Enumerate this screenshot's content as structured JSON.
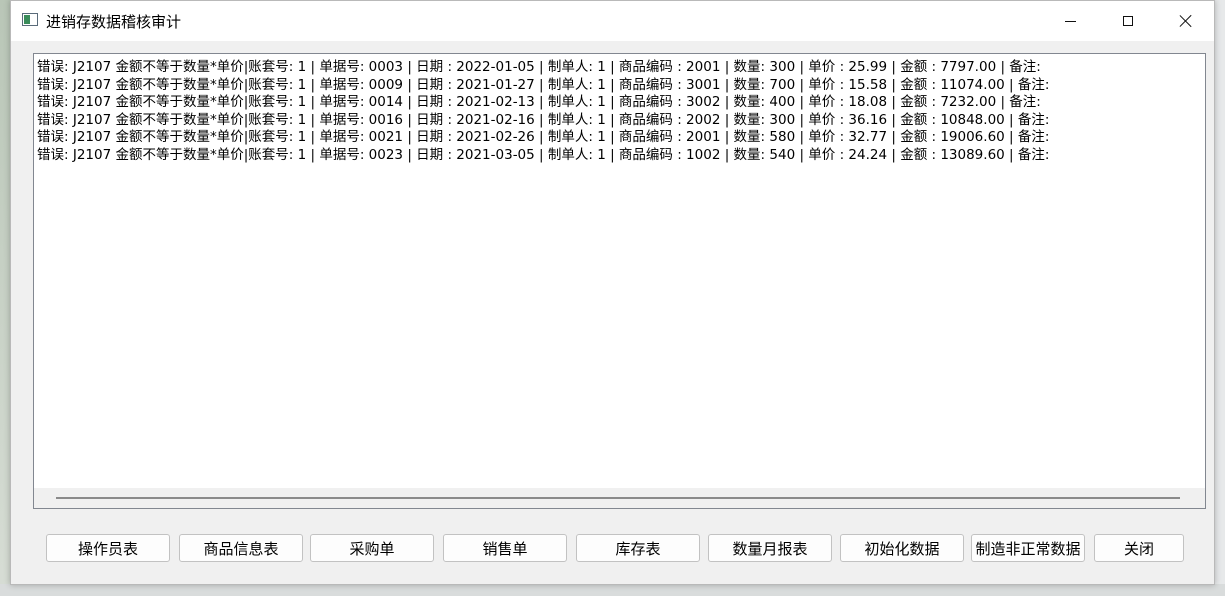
{
  "window": {
    "title": "进销存数据稽核审计"
  },
  "log": {
    "lines": [
      "错误: J2107 金额不等于数量*单价|账套号: 1 | 单据号: 0003 | 日期 : 2022-01-05 | 制单人: 1 | 商品编码 : 2001 | 数量: 300 | 单价 : 25.99 | 金额 : 7797.00 | 备注:",
      "错误: J2107 金额不等于数量*单价|账套号: 1 | 单据号: 0009 | 日期 : 2021-01-27 | 制单人: 1 | 商品编码 : 3001 | 数量: 700 | 单价 : 15.58 | 金额 : 11074.00 | 备注:",
      "错误: J2107 金额不等于数量*单价|账套号: 1 | 单据号: 0014 | 日期 : 2021-02-13 | 制单人: 1 | 商品编码 : 3002 | 数量: 400 | 单价 : 18.08 | 金额 : 7232.00 | 备注:",
      "错误: J2107 金额不等于数量*单价|账套号: 1 | 单据号: 0016 | 日期 : 2021-02-16 | 制单人: 1 | 商品编码 : 2002 | 数量: 300 | 单价 : 36.16 | 金额 : 10848.00 | 备注:",
      "错误: J2107 金额不等于数量*单价|账套号: 1 | 单据号: 0021 | 日期 : 2021-02-26 | 制单人: 1 | 商品编码 : 2001 | 数量: 580 | 单价 : 32.77 | 金额 : 19006.60 | 备注:",
      "错误: J2107 金额不等于数量*单价|账套号: 1 | 单据号: 0023 | 日期 : 2021-03-05 | 制单人: 1 | 商品编码 : 1002 | 数量: 540 | 单价 : 24.24 | 金额 : 13089.60 | 备注:"
    ]
  },
  "buttons": {
    "operators": "操作员表",
    "products": "商品信息表",
    "purchase": "采购单",
    "sales": "销售单",
    "inventory": "库存表",
    "monthly_report": "数量月报表",
    "init_data": "初始化数据",
    "make_abnormal": "制造非正常数据",
    "close": "关闭"
  }
}
